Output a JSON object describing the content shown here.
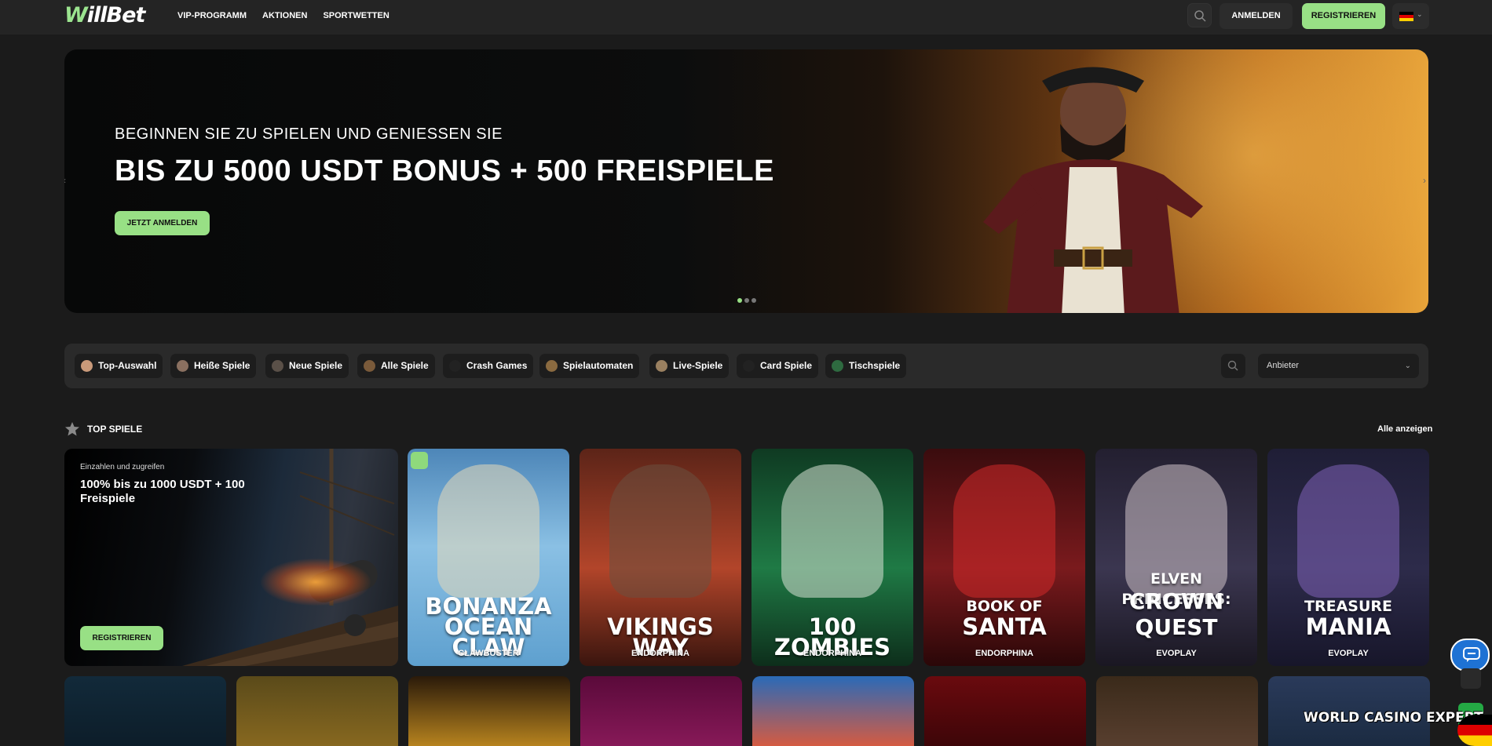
{
  "header": {
    "logo": "WillBet",
    "nav": [
      "VIP-PROGRAMM",
      "AKTIONEN",
      "SPORTWETTEN"
    ],
    "login": "ANMELDEN",
    "register": "REGISTRIEREN"
  },
  "hero": {
    "subtitle": "BEGINNEN SIE ZU SPIELEN UND GENIESSEN SIE",
    "title": "BIS ZU 5000 USDT BONUS + 500 FREISPIELE",
    "button": "JETZT ANMELDEN",
    "slides_total": 3,
    "slide_active": 1
  },
  "categories": [
    {
      "label": "Top-Auswahl",
      "icon": "top-pick-icon"
    },
    {
      "label": "Heiße Spiele",
      "icon": "hot-games-icon"
    },
    {
      "label": "Neue Spiele",
      "icon": "new-games-icon"
    },
    {
      "label": "Alle Spiele",
      "icon": "all-games-icon"
    },
    {
      "label": "Crash Games",
      "icon": "crash-games-icon"
    },
    {
      "label": "Spielautomaten",
      "icon": "slots-icon"
    },
    {
      "label": "Live-Spiele",
      "icon": "live-games-icon"
    },
    {
      "label": "Card Spiele",
      "icon": "card-games-icon"
    },
    {
      "label": "Tischspiele",
      "icon": "table-games-icon"
    }
  ],
  "provider_select": "Anbieter",
  "section": {
    "title": "TOP SPIELE",
    "view_all": "Alle anzeigen"
  },
  "promo": {
    "small": "Einzahlen und zugreifen",
    "big": "100% bis zu 1000 USDT + 100 Freispiele",
    "button": "REGISTRIEREN"
  },
  "games": [
    {
      "line1": "BONANZA",
      "line2": "OCEAN CLAW",
      "provider": "CLAWBUSTER",
      "accent": "#7fb8e0"
    },
    {
      "line1": "",
      "line2": "VIKINGS WAY",
      "provider": "ENDORPHINA",
      "accent": "#b2452a"
    },
    {
      "line1": "",
      "line2": "100 ZOMBIES",
      "provider": "ENDORPHINA",
      "accent": "#1f7a45"
    },
    {
      "line1": "BOOK OF",
      "line2": "SANTA",
      "provider": "ENDORPHINA",
      "accent": "#7a1a1d"
    },
    {
      "line1": "ELVEN PRINCESSES:",
      "line2": "CROWN QUEST",
      "provider": "EVOPLAY",
      "accent": "#3b3650"
    },
    {
      "line1": "TREASURE",
      "line2": "MANIA",
      "provider": "EVOPLAY",
      "accent": "#2d2b4a"
    }
  ],
  "watermark": "WORLD CASINO EXPERT",
  "colors": {
    "accent": "#98e085",
    "background": "#1b1b1b",
    "panel": "#2a2a2a",
    "chat": "#1e72d4"
  }
}
